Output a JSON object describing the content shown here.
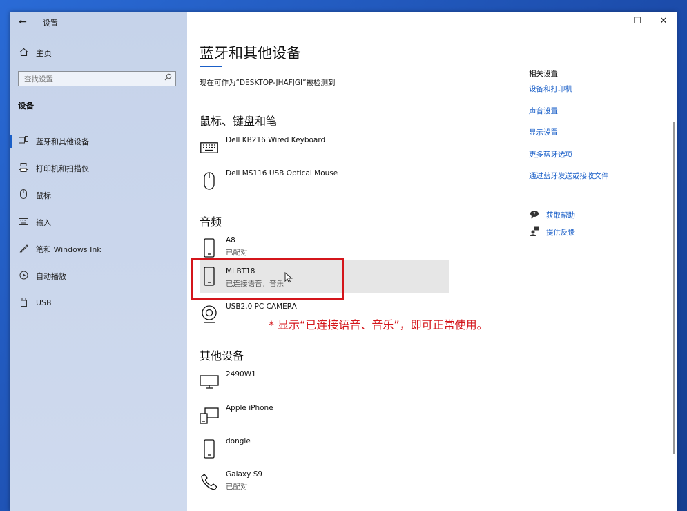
{
  "window": {
    "title": "设置",
    "controls": {
      "minimize": "—",
      "maximize": "☐",
      "close": "✕"
    }
  },
  "sidebar": {
    "back_label": "←",
    "home_label": "主页",
    "search_placeholder": "查找设置",
    "section": "设备",
    "items": [
      {
        "label": "蓝牙和其他设备",
        "icon": "bluetooth-devices-icon"
      },
      {
        "label": "打印机和扫描仪",
        "icon": "printer-icon"
      },
      {
        "label": "鼠标",
        "icon": "mouse-icon"
      },
      {
        "label": "输入",
        "icon": "keyboard-icon"
      },
      {
        "label": "笔和 Windows Ink",
        "icon": "pen-icon"
      },
      {
        "label": "自动播放",
        "icon": "autoplay-icon"
      },
      {
        "label": "USB",
        "icon": "usb-icon"
      }
    ]
  },
  "main": {
    "title": "蓝牙和其他设备",
    "discoverable": "现在可作为“DESKTOP-JHAFJGI”被检测到",
    "groups": [
      {
        "title": "鼠标、键盘和笔",
        "devices": [
          {
            "name": "Dell KB216 Wired Keyboard",
            "status": "",
            "icon": "keyboard-icon"
          },
          {
            "name": "Dell MS116 USB Optical Mouse",
            "status": "",
            "icon": "mouse-icon"
          }
        ]
      },
      {
        "title": "音频",
        "devices": [
          {
            "name": "A8",
            "status": "已配对",
            "icon": "phone-icon"
          },
          {
            "name": "MI BT18",
            "status": "已连接语音，音乐",
            "icon": "phone-icon"
          },
          {
            "name": "USB2.0 PC CAMERA",
            "status": "",
            "icon": "webcam-icon"
          }
        ]
      },
      {
        "title": "其他设备",
        "devices": [
          {
            "name": "2490W1",
            "status": "",
            "icon": "monitor-icon"
          },
          {
            "name": "Apple iPhone",
            "status": "",
            "icon": "devices-icon"
          },
          {
            "name": "dongle",
            "status": "",
            "icon": "phone-icon"
          },
          {
            "name": "Galaxy S9",
            "status": "已配对",
            "icon": "phone-call-icon"
          }
        ]
      }
    ],
    "annotation": "* 显示“已连接语音、音乐”，即可正常使用。"
  },
  "related": {
    "title": "相关设置",
    "links": [
      "设备和打印机",
      "声音设置",
      "显示设置",
      "更多蓝牙选项",
      "通过蓝牙发送或接收文件"
    ]
  },
  "help": {
    "get_help": "获取帮助",
    "feedback": "提供反馈"
  }
}
